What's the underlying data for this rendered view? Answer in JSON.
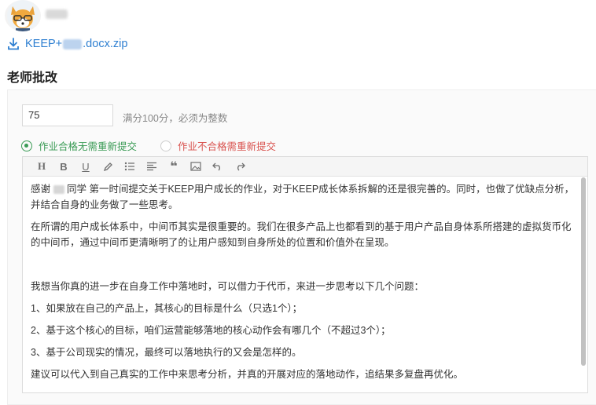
{
  "user": {
    "avatar_icon": "fox-avatar-icon"
  },
  "attachment": {
    "name_prefix": "KEEP+",
    "name_suffix": ".docx.zip",
    "icon": "download-icon",
    "color": "#2e7fd1"
  },
  "review": {
    "title": "老师批改",
    "score_value": "75",
    "score_hint": "满分100分，必须为整数",
    "options": [
      {
        "label": "作业合格无需重新提交",
        "selected": true,
        "color": "#3a9b55"
      },
      {
        "label": "作业不合格需重新提交",
        "selected": false,
        "color": "#d9534f"
      }
    ]
  },
  "editor": {
    "toolbar": [
      {
        "name": "heading-icon",
        "glyph": "H"
      },
      {
        "name": "bold-icon",
        "glyph": "B"
      },
      {
        "name": "underline-icon",
        "glyph": "U"
      },
      {
        "name": "pen-icon",
        "glyph": ""
      },
      {
        "name": "list-icon",
        "glyph": ""
      },
      {
        "name": "align-icon",
        "glyph": ""
      },
      {
        "name": "quote-icon",
        "glyph": "❝"
      },
      {
        "name": "image-icon",
        "glyph": ""
      },
      {
        "name": "undo-icon",
        "glyph": ""
      },
      {
        "name": "redo-icon",
        "glyph": ""
      }
    ],
    "paragraphs": {
      "p1_a": "感谢",
      "p1_b": "同学 第一时间提交关于KEEP用户成长的作业，对于KEEP成长体系拆解的还是很完善的。同时，也做了优缺点分析，并结合自身的业务做了一些思考。",
      "p2": "在所谓的用户成长体系中，中间币其实是很重要的。我们在很多产品上也都看到的基于用户产品自身体系所搭建的虚拟货币化的中间币，通过中间币更清晰明了的让用户感知到自身所处的位置和价值外在呈现。",
      "p3": "我想当你真的进一步在自身工作中落地时，可以借力于代币，来进一步思考以下几个问题：",
      "p4": "1、如果放在自己的产品上，其核心的目标是什么（只选1个）；",
      "p5": "2、基于这个核心的目标，咱们运营能够落地的核心动作会有哪几个（不超过3个）；",
      "p6": "3、基于公司现实的情况，最终可以落地执行的又会是怎样的。",
      "p7": "建议可以代入到自己真实的工作中来思考分析，并真的开展对应的落地动作，追结果多复盘再优化。"
    }
  }
}
